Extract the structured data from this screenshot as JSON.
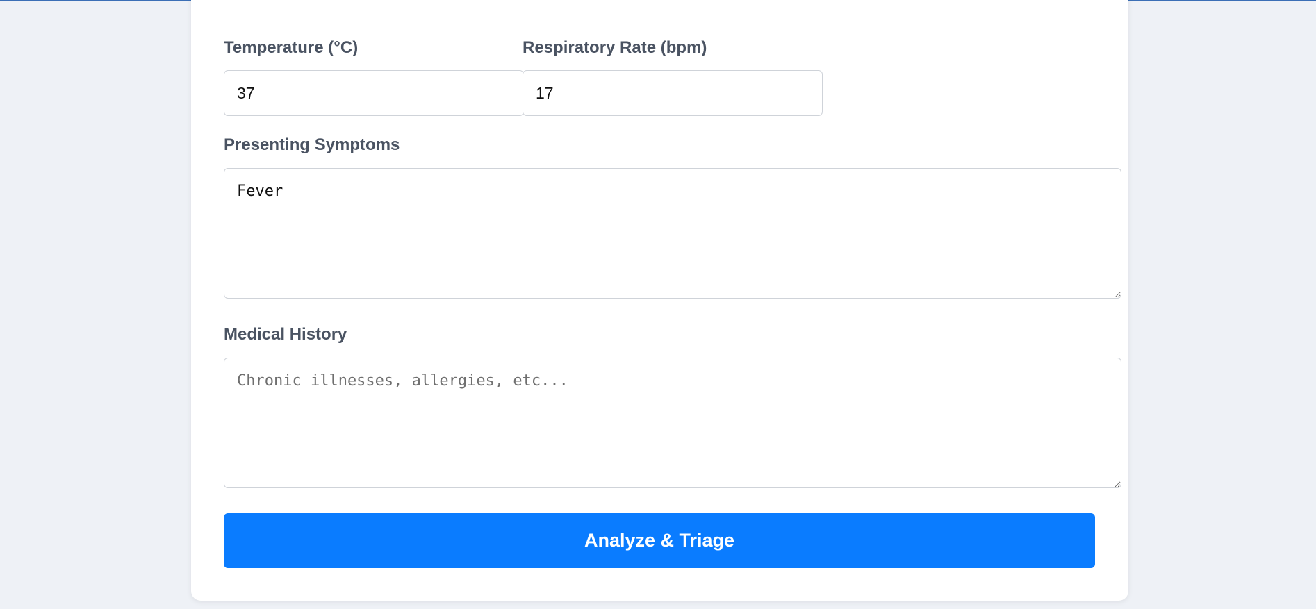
{
  "form": {
    "temperature": {
      "label": "Temperature (°C)",
      "value": "37"
    },
    "respiratory_rate": {
      "label": "Respiratory Rate (bpm)",
      "value": "17"
    },
    "symptoms": {
      "label": "Presenting Symptoms",
      "value": "Fever"
    },
    "medical_history": {
      "label": "Medical History",
      "value": "",
      "placeholder": "Chronic illnesses, allergies, etc..."
    },
    "submit_label": "Analyze & Triage"
  },
  "colors": {
    "primary": "#0a7cff",
    "background": "#eef1f6",
    "label": "#4a5362"
  }
}
